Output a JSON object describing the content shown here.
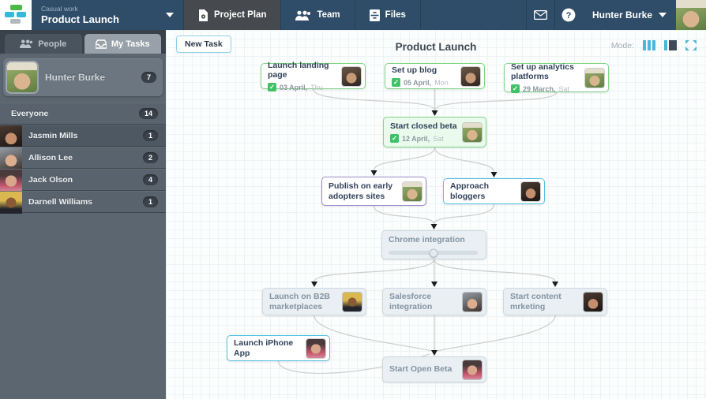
{
  "topbar": {
    "workspace_label": "Casual work",
    "project_name": "Product Launch",
    "tabs": [
      {
        "label": "Project Plan",
        "icon": "document-icon",
        "active": true
      },
      {
        "label": "Team",
        "icon": "team-icon",
        "active": false
      },
      {
        "label": "Files",
        "icon": "files-icon",
        "active": false
      }
    ],
    "icons": [
      "mail-icon",
      "help-icon"
    ],
    "user_name": "Hunter Burke"
  },
  "sidebar": {
    "tabs": [
      {
        "label": "People",
        "icon": "people-icon",
        "active": false
      },
      {
        "label": "My Tasks",
        "icon": "tasks-tray-icon",
        "active": true
      }
    ],
    "me": {
      "name": "Hunter Burke",
      "count": "7"
    },
    "people": [
      {
        "name": "Everyone",
        "count": "14"
      },
      {
        "name": "Jasmin Mills",
        "count": "1"
      },
      {
        "name": "Allison Lee",
        "count": "2"
      },
      {
        "name": "Jack Olson",
        "count": "4"
      },
      {
        "name": "Darnell Williams",
        "count": "1"
      }
    ]
  },
  "canvas": {
    "new_task_label": "New Task",
    "title": "Product Launch",
    "mode_label": "Mode:",
    "mode_icons": [
      "columns-view-icon",
      "split-view-icon",
      "fullscreen-icon"
    ],
    "nodes": [
      {
        "title": "Launch landing page",
        "date": "03 April,",
        "day": "Thu",
        "status": "done",
        "assignee": "dave"
      },
      {
        "title": "Set up blog",
        "date": "05 April,",
        "day": "Mon",
        "status": "done",
        "assignee": "dave"
      },
      {
        "title": "Set up analytics platforms",
        "date": "29 March,",
        "day": "Sat",
        "status": "done",
        "assignee": "hunter"
      },
      {
        "title": "Start closed beta",
        "date": "12 April,",
        "day": "Sat",
        "status": "done-highlight",
        "assignee": "hunter"
      },
      {
        "title": "Publish on early adopters sites",
        "status": "purple-border",
        "assignee": "hunter"
      },
      {
        "title": "Approach bloggers",
        "status": "cyan-border",
        "assignee": "jasmin"
      },
      {
        "title": "Chrome integration",
        "status": "in-progress",
        "progress_percent": 50
      },
      {
        "title": "Launch on B2B marketplaces",
        "status": "future",
        "assignee": "darnell"
      },
      {
        "title": "Salesforce integration",
        "status": "future",
        "assignee": "allison"
      },
      {
        "title": "Start content mrketing",
        "status": "future",
        "assignee": "jasmin"
      },
      {
        "title": "Launch iPhone App",
        "status": "cyan-border",
        "assignee": "jack"
      },
      {
        "title": "Start Open Beta",
        "status": "future",
        "assignee": "jack"
      }
    ]
  },
  "colors": {
    "topbar_bg": "#2f4d68",
    "sidebar_bg": "#5b6670",
    "accent_teal": "#35b9d8",
    "done_green": "#7fd584",
    "check_green": "#3fc168",
    "purple_border": "#9a8cc8",
    "cyan_border": "#55c3e1",
    "future_gray": "#e9eff3"
  }
}
